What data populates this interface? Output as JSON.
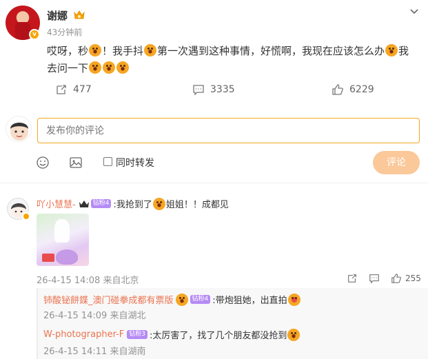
{
  "post": {
    "author": "谢娜",
    "time": "43分钟前",
    "text_parts": [
      "哎呀，秒",
      "！我手抖",
      "第一次遇到这种事情，好慌啊，我现在应该怎么办",
      "我去问一下"
    ],
    "actions": {
      "reposts": "477",
      "comments": "3335",
      "likes": "6229"
    }
  },
  "composer": {
    "placeholder": "发布你的评论",
    "repost_label": "同时转发",
    "submit_label": "评论"
  },
  "comments": [
    {
      "author": "吖小慧慧-",
      "fan_badge": "钻粉4",
      "text_a": ":我抢到了",
      "text_b": "姐姐！！成都见",
      "meta": "26-4-15 14:08 来自北京",
      "likes": "255"
    }
  ],
  "replies": [
    {
      "author": "铈酸铋餅鍱_澳门碰拳成都有票版",
      "fan_badge": "钻粉4",
      "text": ":带炮狙她，出直拍",
      "meta": "26-4-15 14:09 来自湖北"
    },
    {
      "author": "W-photographer-F",
      "fan_badge": "钻粉3",
      "text": ":太厉害了，找了几个朋友都没抢到",
      "meta": "26-4-15 14:11 来自湖南"
    }
  ],
  "colors": {
    "accent": "#eb7350",
    "input_border": "#f5a623",
    "button_bg": "#fbc89a",
    "fan_badge": "#b58bf5"
  },
  "icons": [
    "repost-icon",
    "comment-icon",
    "like-icon",
    "emoji-icon",
    "image-icon",
    "chevron-down-icon",
    "crown-icon",
    "verified-badge-icon"
  ]
}
